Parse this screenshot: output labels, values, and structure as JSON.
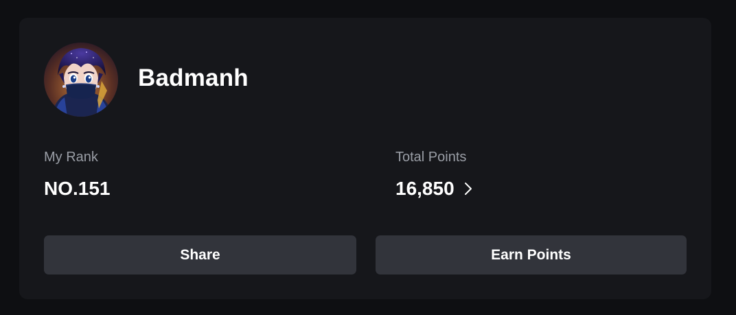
{
  "profile": {
    "username": "Badmanh",
    "avatar_icon": "user-avatar-anime-character"
  },
  "stats": {
    "rank_label": "My Rank",
    "rank_value": "NO.151",
    "points_label": "Total Points",
    "points_value": "16,850",
    "points_link_icon": "chevron-right-icon"
  },
  "actions": {
    "share_label": "Share",
    "earn_label": "Earn Points"
  },
  "colors": {
    "page_background": "#0e0f12",
    "card_background": "#16171b",
    "button_background": "#32343b",
    "label_text": "#9a9ea6",
    "value_text": "#ffffff"
  }
}
